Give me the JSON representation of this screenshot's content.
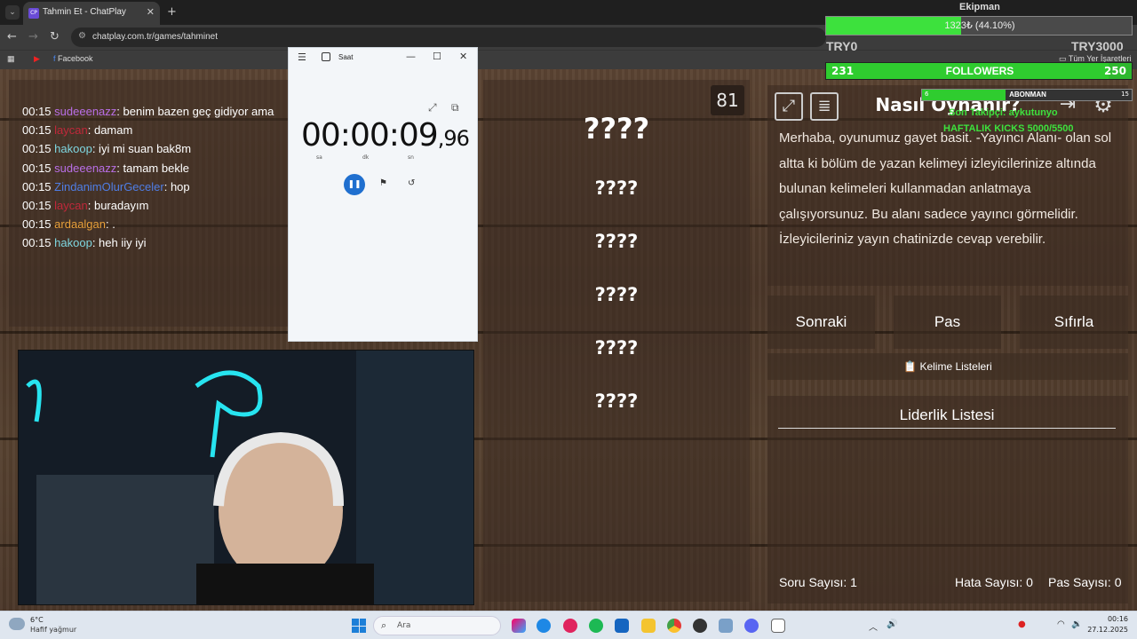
{
  "browser": {
    "tab_title": "Tahmin Et - ChatPlay",
    "tab_favicon": "CP",
    "url": "chatplay.com.tr/games/tahminet",
    "bookmarks": [
      "Facebook"
    ],
    "bookmarks_all": "Tüm Yer İşaretleri"
  },
  "chat": [
    {
      "time": "00:15",
      "user": "sudeeenazz",
      "color": "#b86ee6",
      "msg": ": benim bazen geç gidiyor ama"
    },
    {
      "time": "00:15",
      "user": "laycan",
      "color": "#c0283a",
      "msg": ": damam"
    },
    {
      "time": "00:15",
      "user": "hakoop",
      "color": "#7ed6e0",
      "msg": ": iyi mi suan bak8m"
    },
    {
      "time": "00:15",
      "user": "sudeeenazz",
      "color": "#b86ee6",
      "msg": ": tamam bekle"
    },
    {
      "time": "00:15",
      "user": "ZindanimOlurGeceler",
      "color": "#4f7ee6",
      "msg": ": hop"
    },
    {
      "time": "00:15",
      "user": "laycan",
      "color": "#c0283a",
      "msg": ": buradayım"
    },
    {
      "time": "00:15",
      "user": "ardaalgan",
      "color": "#e8a03a",
      "msg": ": ."
    },
    {
      "time": "00:15",
      "user": "hakoop",
      "color": "#7ed6e0",
      "msg": ": heh iiy iyi"
    }
  ],
  "game": {
    "timer": "81",
    "hidden_words": [
      "????",
      "????",
      "????",
      "????",
      "????",
      "????"
    ],
    "how_to_title": "Nasıl Oynanır?",
    "how_to_text": "Merhaba, oyunumuz gayet basit. -Yayıncı Alanı- olan sol altta ki bölüm de yazan kelimeyi izleyicilerinize altında bulunan kelimeleri kullanmadan anlatmaya çalışıyorsunuz. Bu alanı sadece yayıncı görmelidir. İzleyicileriniz yayın chatinizde cevap verebilir.",
    "buttons": {
      "next": "Sonraki",
      "pass": "Pas",
      "reset": "Sıfırla"
    },
    "word_lists": "Kelime Listeleri",
    "word_lists_icon": "📋",
    "leaderboard_title": "Liderlik Listesi",
    "stats": {
      "questions": "Soru Sayısı: 1",
      "errors": "Hata Sayısı: 0",
      "passes": "Pas Sayısı: 0"
    }
  },
  "clock_app": {
    "title": "Saat",
    "time_main": "00:00:09",
    "time_ms": ",96",
    "unit_h": "sa",
    "unit_m": "dk",
    "unit_s": "sn"
  },
  "overlay": {
    "goal_title": "Ekipman",
    "goal_text": "1323₺ (44.10%)",
    "goal_fraction": 0.441,
    "goal_left": "TRY0",
    "goal_right": "TRY3000",
    "followers_label": "FOLLOWERS",
    "followers_current": "231",
    "followers_target": "250",
    "followers_fraction": 0.924,
    "sub_label": "ABONMAN",
    "sub_current": "6",
    "sub_target": "15",
    "sub_fraction": 0.4,
    "last_follower": "Son Takipçi: aykutunyo",
    "weekly_kicks": "HAFTALIK KICKS 5000/5500"
  },
  "taskbar": {
    "weather_temp": "6°C",
    "weather_desc": "Hafif yağmur",
    "search_placeholder": "Ara",
    "time": "00:16",
    "date": "27.12.2025"
  }
}
